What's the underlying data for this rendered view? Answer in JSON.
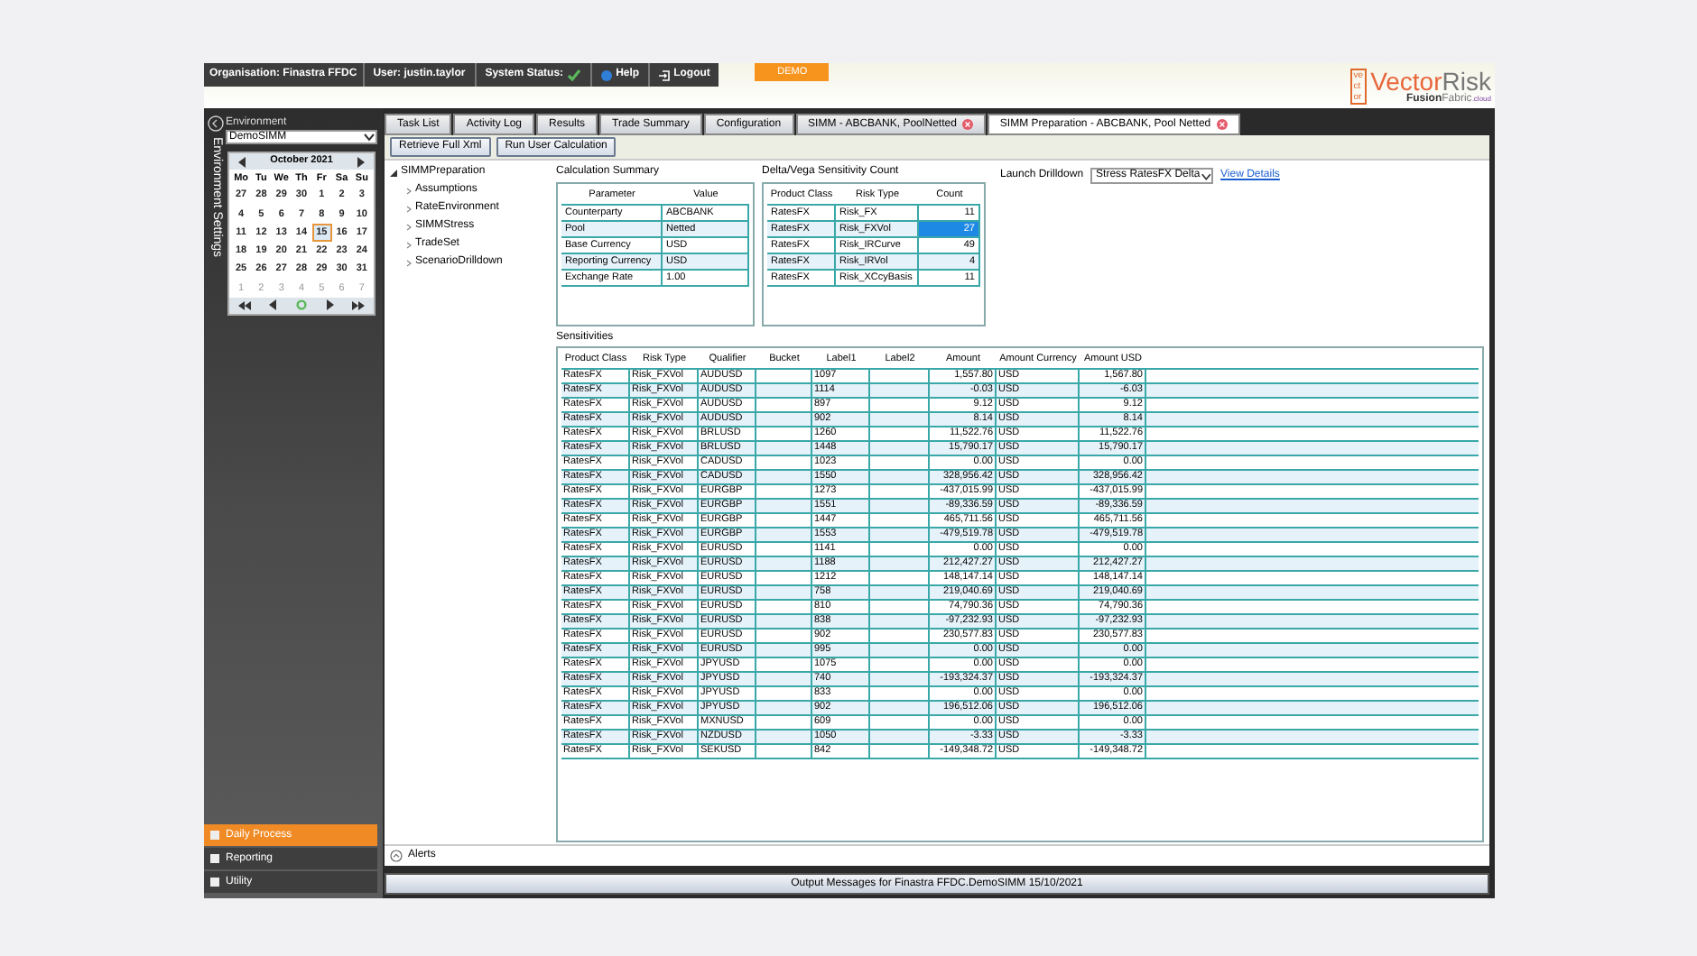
{
  "header": {
    "organisation": "Organisation: Finastra FFDC",
    "user": "User: justin.taylor",
    "system_status": "System Status:",
    "system_ok": true,
    "help": "Help",
    "logout": "Logout",
    "demo": "DEMO",
    "logo": {
      "mark_rows": [
        "ve",
        "ct",
        "or"
      ],
      "brand_first": "Vector",
      "brand_second": "Risk",
      "sub_first": "Fusion",
      "sub_second": "Fabric",
      "sub_suffix": ".cloud"
    }
  },
  "sidebar": {
    "title": "Environment Settings",
    "environment_label": "Environment",
    "environment_value": "DemoSIMM",
    "calendar": {
      "month": "October 2021",
      "weekdays": [
        "Mo",
        "Tu",
        "We",
        "Th",
        "Fr",
        "Sa",
        "Su"
      ],
      "weeks": [
        [
          {
            "day": "27",
            "dimmed": false,
            "selected": false
          },
          {
            "day": "28",
            "dimmed": false,
            "selected": false
          },
          {
            "day": "29",
            "dimmed": false,
            "selected": false
          },
          {
            "day": "30",
            "dimmed": false,
            "selected": false
          },
          {
            "day": "1",
            "dimmed": false,
            "selected": false
          },
          {
            "day": "2",
            "dimmed": false,
            "selected": false
          },
          {
            "day": "3",
            "dimmed": false,
            "selected": false
          }
        ],
        [
          {
            "day": "4",
            "dimmed": false,
            "selected": false
          },
          {
            "day": "5",
            "dimmed": false,
            "selected": false
          },
          {
            "day": "6",
            "dimmed": false,
            "selected": false
          },
          {
            "day": "7",
            "dimmed": false,
            "selected": false
          },
          {
            "day": "8",
            "dimmed": false,
            "selected": false
          },
          {
            "day": "9",
            "dimmed": false,
            "selected": false
          },
          {
            "day": "10",
            "dimmed": false,
            "selected": false
          }
        ],
        [
          {
            "day": "11",
            "dimmed": false,
            "selected": false
          },
          {
            "day": "12",
            "dimmed": false,
            "selected": false
          },
          {
            "day": "13",
            "dimmed": false,
            "selected": false
          },
          {
            "day": "14",
            "dimmed": false,
            "selected": false
          },
          {
            "day": "15",
            "dimmed": false,
            "selected": true
          },
          {
            "day": "16",
            "dimmed": false,
            "selected": false
          },
          {
            "day": "17",
            "dimmed": false,
            "selected": false
          }
        ],
        [
          {
            "day": "18",
            "dimmed": false,
            "selected": false
          },
          {
            "day": "19",
            "dimmed": false,
            "selected": false
          },
          {
            "day": "20",
            "dimmed": false,
            "selected": false
          },
          {
            "day": "21",
            "dimmed": false,
            "selected": false
          },
          {
            "day": "22",
            "dimmed": false,
            "selected": false
          },
          {
            "day": "23",
            "dimmed": false,
            "selected": false
          },
          {
            "day": "24",
            "dimmed": false,
            "selected": false
          }
        ],
        [
          {
            "day": "25",
            "dimmed": false,
            "selected": false
          },
          {
            "day": "26",
            "dimmed": false,
            "selected": false
          },
          {
            "day": "27",
            "dimmed": false,
            "selected": false
          },
          {
            "day": "28",
            "dimmed": false,
            "selected": false
          },
          {
            "day": "29",
            "dimmed": false,
            "selected": false
          },
          {
            "day": "30",
            "dimmed": false,
            "selected": false
          },
          {
            "day": "31",
            "dimmed": false,
            "selected": false
          }
        ],
        [
          {
            "day": "1",
            "dimmed": true,
            "selected": false
          },
          {
            "day": "2",
            "dimmed": true,
            "selected": false
          },
          {
            "day": "3",
            "dimmed": true,
            "selected": false
          },
          {
            "day": "4",
            "dimmed": true,
            "selected": false
          },
          {
            "day": "5",
            "dimmed": true,
            "selected": false
          },
          {
            "day": "6",
            "dimmed": true,
            "selected": false
          },
          {
            "day": "7",
            "dimmed": true,
            "selected": false
          }
        ]
      ]
    },
    "bottom_nav": [
      {
        "label": "Daily Process",
        "selected": true
      },
      {
        "label": "Reporting",
        "selected": false
      },
      {
        "label": "Utility",
        "selected": false
      }
    ]
  },
  "tabs": [
    {
      "label": "Task List",
      "closable": false,
      "selected": false
    },
    {
      "label": "Activity Log",
      "closable": false,
      "selected": false
    },
    {
      "label": "Results",
      "closable": false,
      "selected": false
    },
    {
      "label": "Trade Summary",
      "closable": false,
      "selected": false
    },
    {
      "label": "Configuration",
      "closable": false,
      "selected": false
    },
    {
      "label": "SIMM - ABCBANK, PoolNetted",
      "closable": true,
      "selected": false
    },
    {
      "label": "SIMM Preparation - ABCBANK, Pool Netted",
      "closable": true,
      "selected": true
    }
  ],
  "toolbar": [
    "Retrieve Full Xml",
    "Run User Calculation"
  ],
  "tree": {
    "label": "SIMMPreparation",
    "expanded": true,
    "children": [
      {
        "label": "Assumptions"
      },
      {
        "label": "RateEnvironment"
      },
      {
        "label": "SIMMStress"
      },
      {
        "label": "TradeSet"
      },
      {
        "label": "ScenarioDrilldown"
      }
    ]
  },
  "calculation_summary": {
    "title": "Calculation Summary",
    "columns": [
      "Parameter",
      "Value"
    ],
    "rows": [
      [
        "Counterparty",
        "ABCBANK"
      ],
      [
        "Pool",
        "Netted"
      ],
      [
        "Base Currency",
        "USD"
      ],
      [
        "Reporting Currency",
        "USD"
      ],
      [
        "Exchange Rate",
        "1.00"
      ]
    ]
  },
  "sensitivity_count": {
    "title": "Delta/Vega Sensitivity Count",
    "columns": [
      "Product Class",
      "Risk Type",
      "Count"
    ],
    "rows": [
      {
        "cells": [
          "RatesFX",
          "Risk_FX",
          "11"
        ],
        "selected": false
      },
      {
        "cells": [
          "RatesFX",
          "Risk_FXVol",
          "27"
        ],
        "selected": true
      },
      {
        "cells": [
          "RatesFX",
          "Risk_IRCurve",
          "49"
        ],
        "selected": false
      },
      {
        "cells": [
          "RatesFX",
          "Risk_IRVol",
          "4"
        ],
        "selected": false
      },
      {
        "cells": [
          "RatesFX",
          "Risk_XCcyBasis",
          "11"
        ],
        "selected": false
      }
    ]
  },
  "drilldown": {
    "label": "Launch Drilldown",
    "value": "Stress RatesFX Delta",
    "link": "View Details"
  },
  "sensitivities": {
    "title": "Sensitivities",
    "columns": [
      "Product Class",
      "Risk Type",
      "Qualifier",
      "Bucket",
      "Label1",
      "Label2",
      "Amount",
      "Amount Currency",
      "Amount USD"
    ],
    "rows": [
      [
        "RatesFX",
        "Risk_FXVol",
        "AUDUSD",
        "",
        "1097",
        "",
        "1,557.80",
        "USD",
        "1,567.80"
      ],
      [
        "RatesFX",
        "Risk_FXVol",
        "AUDUSD",
        "",
        "1114",
        "",
        "-0.03",
        "USD",
        "-6.03"
      ],
      [
        "RatesFX",
        "Risk_FXVol",
        "AUDUSD",
        "",
        "897",
        "",
        "9.12",
        "USD",
        "9.12"
      ],
      [
        "RatesFX",
        "Risk_FXVol",
        "AUDUSD",
        "",
        "902",
        "",
        "8.14",
        "USD",
        "8.14"
      ],
      [
        "RatesFX",
        "Risk_FXVol",
        "BRLUSD",
        "",
        "1260",
        "",
        "11,522.76",
        "USD",
        "11,522.76"
      ],
      [
        "RatesFX",
        "Risk_FXVol",
        "BRLUSD",
        "",
        "1448",
        "",
        "15,790.17",
        "USD",
        "15,790.17"
      ],
      [
        "RatesFX",
        "Risk_FXVol",
        "CADUSD",
        "",
        "1023",
        "",
        "0.00",
        "USD",
        "0.00"
      ],
      [
        "RatesFX",
        "Risk_FXVol",
        "CADUSD",
        "",
        "1550",
        "",
        "328,956.42",
        "USD",
        "328,956.42"
      ],
      [
        "RatesFX",
        "Risk_FXVol",
        "EURGBP",
        "",
        "1273",
        "",
        "-437,015.99",
        "USD",
        "-437,015.99"
      ],
      [
        "RatesFX",
        "Risk_FXVol",
        "EURGBP",
        "",
        "1551",
        "",
        "-89,336.59",
        "USD",
        "-89,336.59"
      ],
      [
        "RatesFX",
        "Risk_FXVol",
        "EURGBP",
        "",
        "1447",
        "",
        "465,711.56",
        "USD",
        "465,711.56"
      ],
      [
        "RatesFX",
        "Risk_FXVol",
        "EURGBP",
        "",
        "1553",
        "",
        "-479,519.78",
        "USD",
        "-479,519.78"
      ],
      [
        "RatesFX",
        "Risk_FXVol",
        "EURUSD",
        "",
        "1141",
        "",
        "0.00",
        "USD",
        "0.00"
      ],
      [
        "RatesFX",
        "Risk_FXVol",
        "EURUSD",
        "",
        "1188",
        "",
        "212,427.27",
        "USD",
        "212,427.27"
      ],
      [
        "RatesFX",
        "Risk_FXVol",
        "EURUSD",
        "",
        "1212",
        "",
        "148,147.14",
        "USD",
        "148,147.14"
      ],
      [
        "RatesFX",
        "Risk_FXVol",
        "EURUSD",
        "",
        "758",
        "",
        "219,040.69",
        "USD",
        "219,040.69"
      ],
      [
        "RatesFX",
        "Risk_FXVol",
        "EURUSD",
        "",
        "810",
        "",
        "74,790.36",
        "USD",
        "74,790.36"
      ],
      [
        "RatesFX",
        "Risk_FXVol",
        "EURUSD",
        "",
        "838",
        "",
        "-97,232.93",
        "USD",
        "-97,232.93"
      ],
      [
        "RatesFX",
        "Risk_FXVol",
        "EURUSD",
        "",
        "902",
        "",
        "230,577.83",
        "USD",
        "230,577.83"
      ],
      [
        "RatesFX",
        "Risk_FXVol",
        "EURUSD",
        "",
        "995",
        "",
        "0.00",
        "USD",
        "0.00"
      ],
      [
        "RatesFX",
        "Risk_FXVol",
        "JPYUSD",
        "",
        "1075",
        "",
        "0.00",
        "USD",
        "0.00"
      ],
      [
        "RatesFX",
        "Risk_FXVol",
        "JPYUSD",
        "",
        "740",
        "",
        "-193,324.37",
        "USD",
        "-193,324.37"
      ],
      [
        "RatesFX",
        "Risk_FXVol",
        "JPYUSD",
        "",
        "833",
        "",
        "0.00",
        "USD",
        "0.00"
      ],
      [
        "RatesFX",
        "Risk_FXVol",
        "JPYUSD",
        "",
        "902",
        "",
        "196,512.06",
        "USD",
        "196,512.06"
      ],
      [
        "RatesFX",
        "Risk_FXVol",
        "MXNUSD",
        "",
        "609",
        "",
        "0.00",
        "USD",
        "0.00"
      ],
      [
        "RatesFX",
        "Risk_FXVol",
        "NZDUSD",
        "",
        "1050",
        "",
        "-3.33",
        "USD",
        "-3.33"
      ],
      [
        "RatesFX",
        "Risk_FXVol",
        "SEKUSD",
        "",
        "842",
        "",
        "-149,348.72",
        "USD",
        "-149,348.72"
      ]
    ]
  },
  "alerts": {
    "label": "Alerts",
    "expanded": false
  },
  "output_bar": "Output Messages for Finastra FFDC.DemoSIMM 15/10/2021"
}
